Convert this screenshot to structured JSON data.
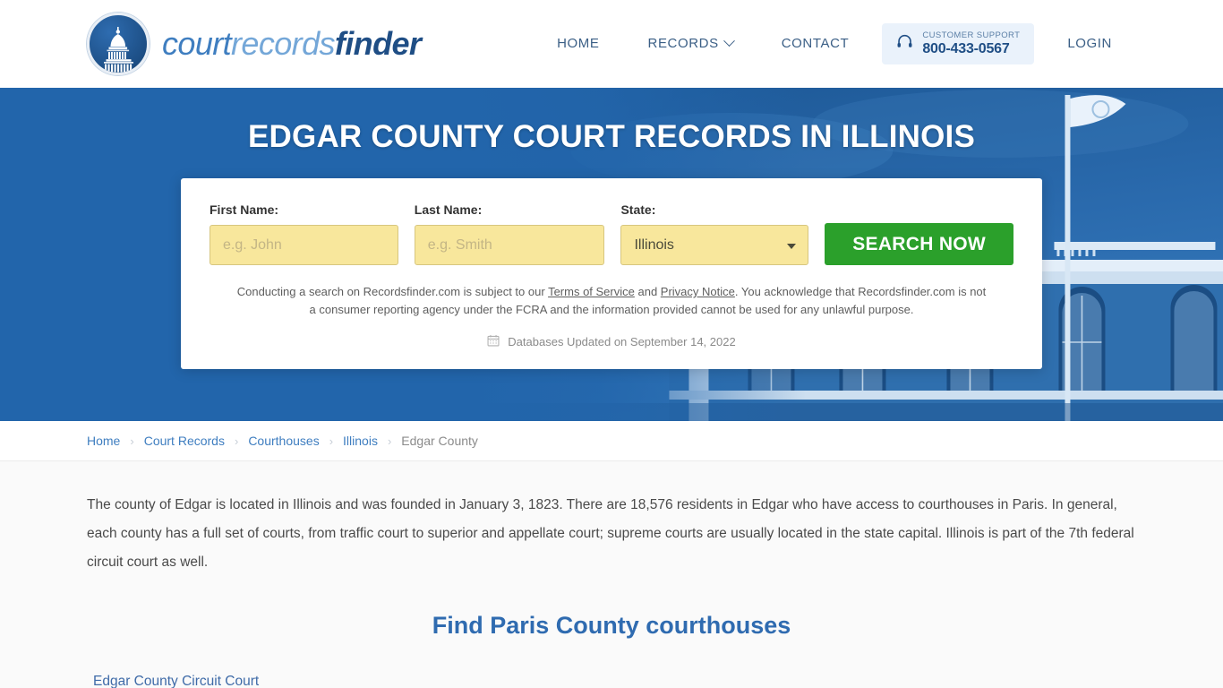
{
  "header": {
    "logo_icon": "capitol-dome-icon",
    "brand": {
      "part1": "court",
      "part2": "records",
      "part3": "finder"
    },
    "nav": [
      {
        "label": "HOME",
        "name": "nav-home"
      },
      {
        "label": "RECORDS",
        "name": "nav-records",
        "has_chevron": true
      },
      {
        "label": "CONTACT",
        "name": "nav-contact"
      }
    ],
    "support": {
      "icon": "headset-icon",
      "label": "CUSTOMER SUPPORT",
      "phone": "800-433-0567"
    },
    "login_label": "LOGIN"
  },
  "hero": {
    "title": "EDGAR COUNTY COURT RECORDS IN ILLINOIS",
    "background_color": "#2265ab"
  },
  "search": {
    "first_name": {
      "label": "First Name:",
      "value": "",
      "placeholder": "e.g. John"
    },
    "last_name": {
      "label": "Last Name:",
      "value": "",
      "placeholder": "e.g. Smith"
    },
    "state": {
      "label": "State:",
      "value": "Illinois"
    },
    "submit_label": "SEARCH NOW",
    "disclaimer_1": "Conducting a search on Recordsfinder.com is subject to our ",
    "terms_link": "Terms of Service",
    "disclaimer_and": " and ",
    "privacy_link": "Privacy Notice",
    "disclaimer_2": ". You acknowledge that Recordsfinder.com is not a consumer reporting agency under the FCRA and the information provided cannot be used for any unlawful purpose.",
    "updated_icon": "calendar-icon",
    "updated_text": "Databases Updated on September 14, 2022"
  },
  "breadcrumb": {
    "items": [
      {
        "label": "Home",
        "current": false
      },
      {
        "label": "Court Records",
        "current": false
      },
      {
        "label": "Courthouses",
        "current": false
      },
      {
        "label": "Illinois",
        "current": false
      },
      {
        "label": "Edgar County",
        "current": true
      }
    ],
    "separator": "›"
  },
  "main": {
    "intro": "The county of Edgar is located in Illinois and was founded in January 3, 1823. There are 18,576 residents in Edgar who have access to courthouses in Paris. In general, each county has a full set of courts, from traffic court to superior and appellate court; supreme courts are usually located in the state capital. Illinois is part of the 7th federal circuit court as well.",
    "section_title": "Find Paris County courthouses",
    "courthouses": [
      {
        "name": "Edgar County Circuit Court"
      }
    ]
  },
  "colors": {
    "brand_blue": "#1f4e85",
    "hero_blue": "#2265ab",
    "accent_green": "#2ba02b",
    "input_yellow": "#f8e79c",
    "link_blue": "#3f7ec0"
  }
}
